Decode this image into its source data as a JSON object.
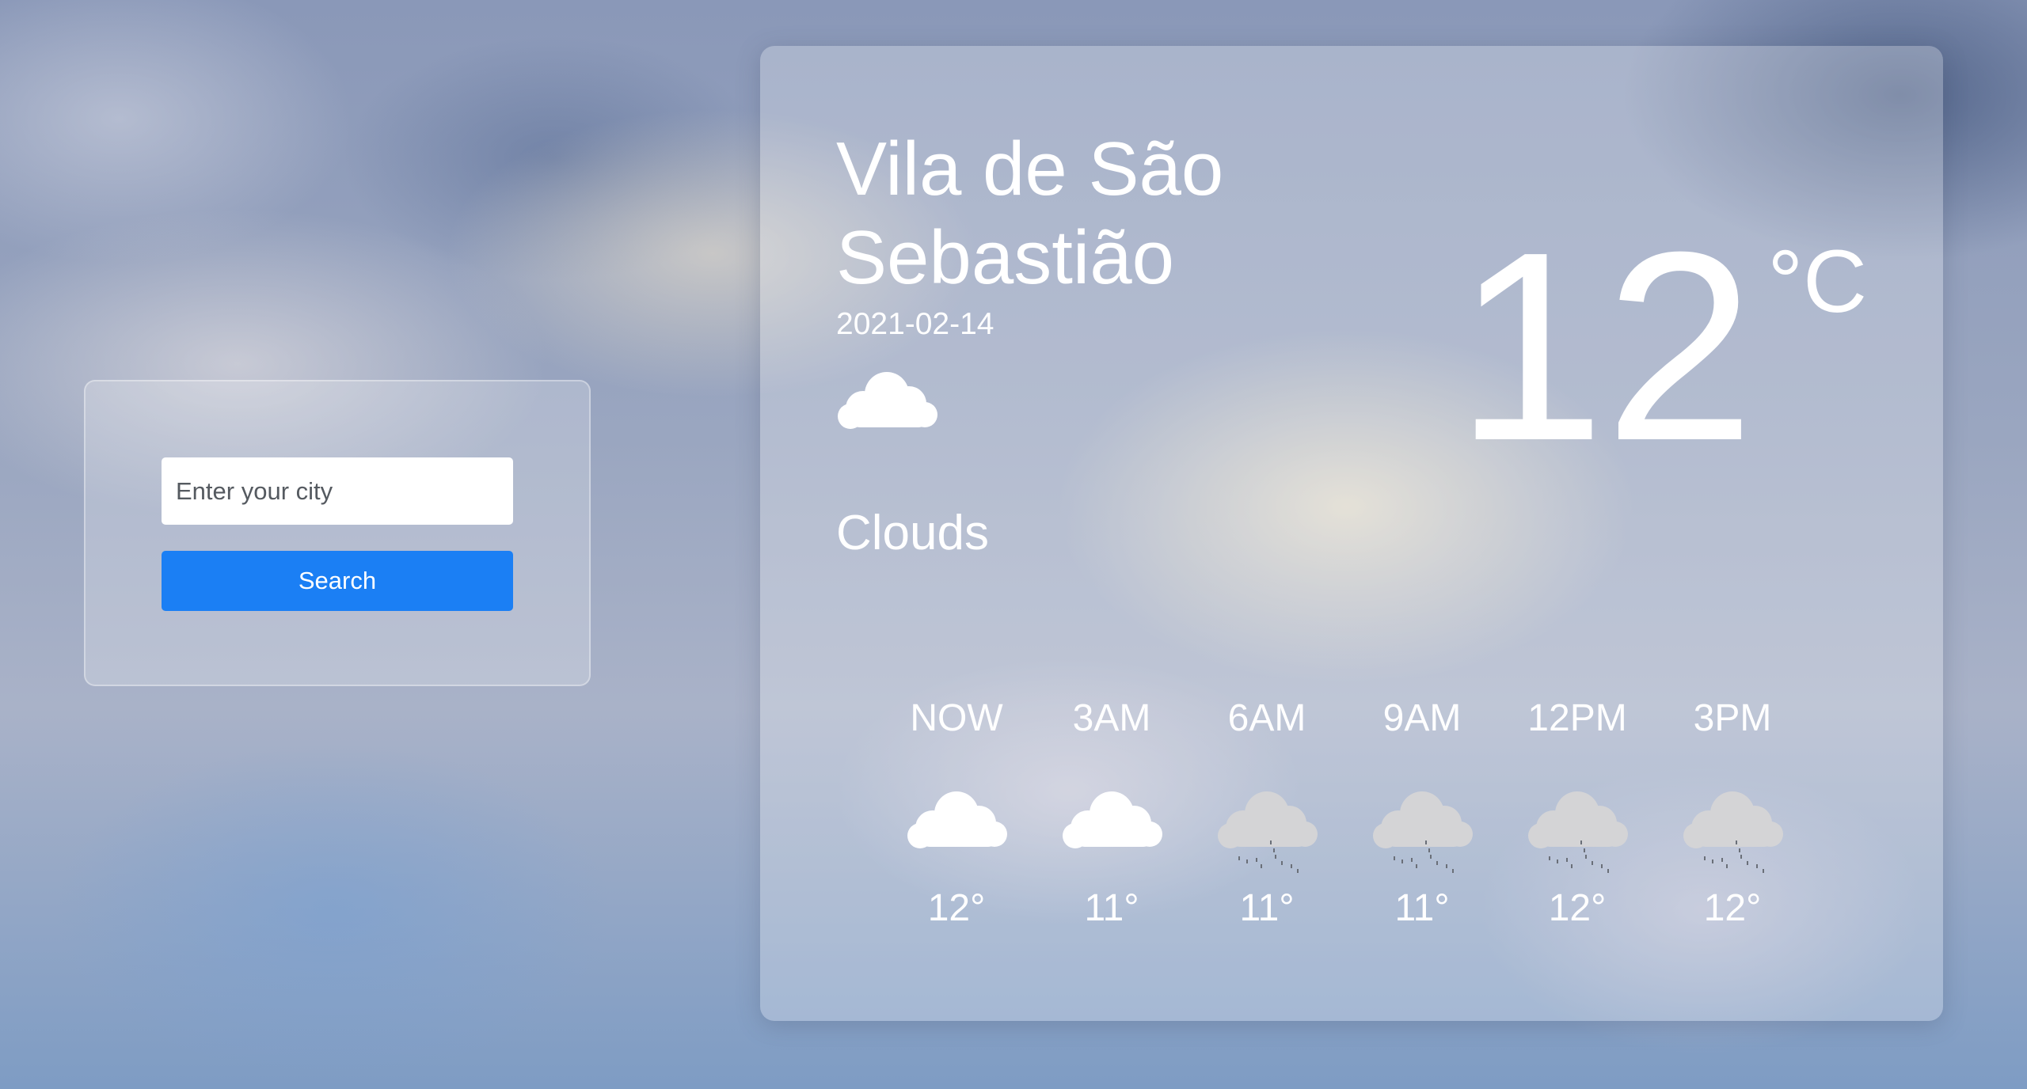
{
  "search": {
    "placeholder": "Enter your city",
    "value": "",
    "button_label": "Search",
    "button_color": "#1b7ff4"
  },
  "weather": {
    "city": "Vila de São Sebastião",
    "date": "2021-02-14",
    "condition": "Clouds",
    "condition_icon": "cloud-icon",
    "temperature": "12",
    "unit": "°C"
  },
  "forecast": [
    {
      "time": "NOW",
      "temp": "12°",
      "icon": "cloud-icon"
    },
    {
      "time": "3AM",
      "temp": "11°",
      "icon": "cloud-icon"
    },
    {
      "time": "6AM",
      "temp": "11°",
      "icon": "rain-cloud-icon"
    },
    {
      "time": "9AM",
      "temp": "11°",
      "icon": "rain-cloud-icon"
    },
    {
      "time": "12PM",
      "temp": "12°",
      "icon": "rain-cloud-icon"
    },
    {
      "time": "3PM",
      "temp": "12°",
      "icon": "rain-cloud-icon"
    }
  ]
}
